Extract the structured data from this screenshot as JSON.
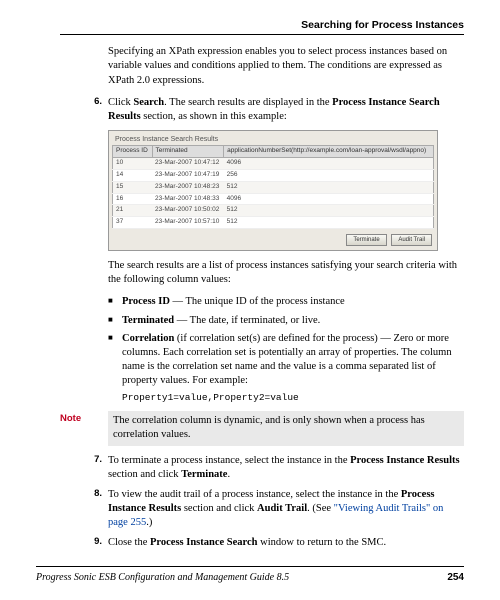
{
  "header": {
    "section_title": "Searching for Process Instances"
  },
  "intro_para": "Specifying an XPath expression enables you to select process instances based on variable values and conditions applied to them. The conditions are expressed as XPath 2.0 expressions.",
  "step6": {
    "num": "6.",
    "text_pre": "Click ",
    "b1": "Search",
    "text_mid": ". The search results are displayed in the ",
    "b2": "Process Instance Search Results",
    "text_post": " section, as shown in this example:"
  },
  "screenshot": {
    "title": "Process Instance Search Results",
    "columns": [
      "Process ID",
      "Terminated",
      "applicationNumberSet(http://example.com/loan-approval/wsdl/appno)"
    ],
    "rows": [
      [
        "10",
        "23-Mar-2007 10:47:12",
        "4096"
      ],
      [
        "14",
        "23-Mar-2007 10:47:19",
        "256"
      ],
      [
        "15",
        "23-Mar-2007 10:48:23",
        "512"
      ],
      [
        "16",
        "23-Mar-2007 10:48:33",
        "4096"
      ],
      [
        "21",
        "23-Mar-2007 10:50:02",
        "512"
      ],
      [
        "37",
        "23-Mar-2007 10:57:10",
        "512"
      ]
    ],
    "btn_terminate": "Terminate",
    "btn_audit": "Audit Trail"
  },
  "results_para": "The search results are a list of process instances satisfying your search criteria with the following column values:",
  "bullets": {
    "b1": {
      "bold": "Process ID",
      "rest": " — The unique ID of the process instance"
    },
    "b2": {
      "bold": "Terminated",
      "rest": " — The date, if terminated, or live."
    },
    "b3": {
      "bold": "Correlation",
      "rest": " (if correlation set(s) are defined for the process) — Zero or more columns. Each correlation set is potentially an array of properties. The column name is the correlation set name and the value is a comma separated list of property values. For example:"
    }
  },
  "code_example": "Property1=value,Property2=value",
  "note": {
    "label": "Note",
    "body": "The correlation column is dynamic, and is only shown when a process has correlation values."
  },
  "step7": {
    "num": "7.",
    "pre": "To terminate a process instance, select the instance in the ",
    "b1": "Process Instance Results",
    "mid": " section and click ",
    "b2": "Terminate",
    "post": "."
  },
  "step8": {
    "num": "8.",
    "pre": "To view the audit trail of a process instance, select the instance in the ",
    "b1": "Process Instance Results",
    "mid": " section and click ",
    "b2": "Audit Trail",
    "post1": ". (See ",
    "link": "\"Viewing Audit Trails\" on page 255",
    "post2": ".)"
  },
  "step9": {
    "num": "9.",
    "pre": "Close the ",
    "b1": "Process Instance Search",
    "post": " window to return to the SMC."
  },
  "footer": {
    "doc_title": "Progress Sonic ESB Configuration and Management Guide 8.5",
    "page_number": "254"
  }
}
